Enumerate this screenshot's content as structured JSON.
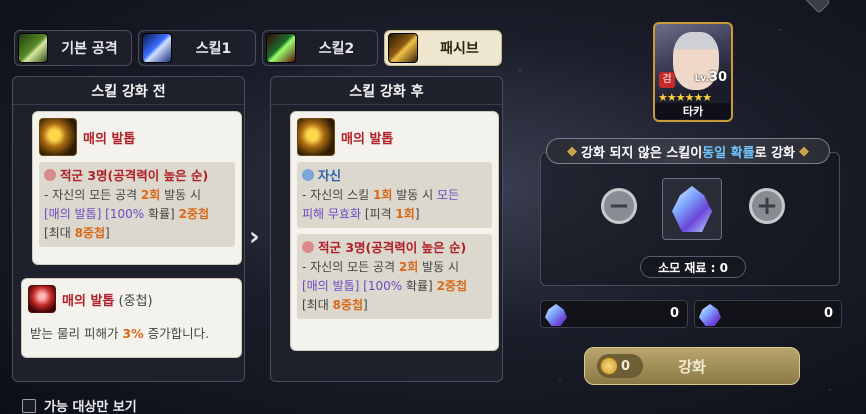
{
  "tabs": [
    {
      "label": "기본 공격",
      "icon": "basic-attack-icon"
    },
    {
      "label": "스킬1",
      "icon": "skill1-icon"
    },
    {
      "label": "스킬2",
      "icon": "skill2-icon"
    },
    {
      "label": "패시브",
      "icon": "passive-icon",
      "active": true
    }
  ],
  "before": {
    "title": "스킬 강화 전",
    "card1": {
      "name": "매의 발톱",
      "target": "적군 3명(공격력이 높은 순)",
      "line1_a": "- 자신의 모든 공격 ",
      "line1_b": "2회",
      "line1_c": " 발동 시",
      "line2_a": "[매의 발톱]",
      "line2_b": " [100%",
      "line2_c": " 확률] ",
      "line2_d": "2중첩",
      "line3_a": "[최대 ",
      "line3_b": "8중첩",
      "line3_c": "]"
    },
    "card2": {
      "name": "매의 발톱",
      "name_sub": " (중첩)",
      "text_a": "받는 물리 피해가 ",
      "text_b": "3%",
      "text_c": " 증가합니다."
    }
  },
  "after": {
    "title": "스킬 강화 후",
    "card": {
      "name": "매의 발톱",
      "self_target": "자신",
      "self_l1_a": "- 자신의 스킬 ",
      "self_l1_b": "1회",
      "self_l1_c": " 발동 시 ",
      "self_l1_d": "모든",
      "self_l2_a": "피해 무효화",
      "self_l2_b": " [피격 ",
      "self_l2_c": "1회",
      "self_l2_d": "]",
      "enemy_target": "적군 3명(공격력이 높은 순)",
      "en_l1_a": "- 자신의 모든 공격 ",
      "en_l1_b": "2회",
      "en_l1_c": " 발동 시",
      "en_l2_a": "[매의 발톱]",
      "en_l2_b": " [100%",
      "en_l2_c": " 확률] ",
      "en_l2_d": "2중첩",
      "en_l3_a": "[최대 ",
      "en_l3_b": "8중첩",
      "en_l3_c": "]"
    }
  },
  "hero": {
    "name": "타카",
    "level_prefix": "Lv.",
    "level": "30",
    "stars": "★★★★★★",
    "badge": "검"
  },
  "banner": {
    "a": "강화 되지 않은 스킬이 ",
    "b": "동일 확률",
    "c": "로 강화",
    "left_bracket": "◆",
    "right_bracket": "◆"
  },
  "material": {
    "minus": "−",
    "plus": "+",
    "label": "소모 재료 : 0"
  },
  "counts": [
    {
      "value": "0"
    },
    {
      "value": "0"
    }
  ],
  "enhance": {
    "cost": "0",
    "label": "강화"
  },
  "filter": {
    "label": "가능 대상만 보기"
  },
  "colors": {
    "accent_gold": "#c9a64a",
    "highlight_blue": "#6fc6ff",
    "damage_red": "#b0202a",
    "number_orange": "#d9691a"
  }
}
